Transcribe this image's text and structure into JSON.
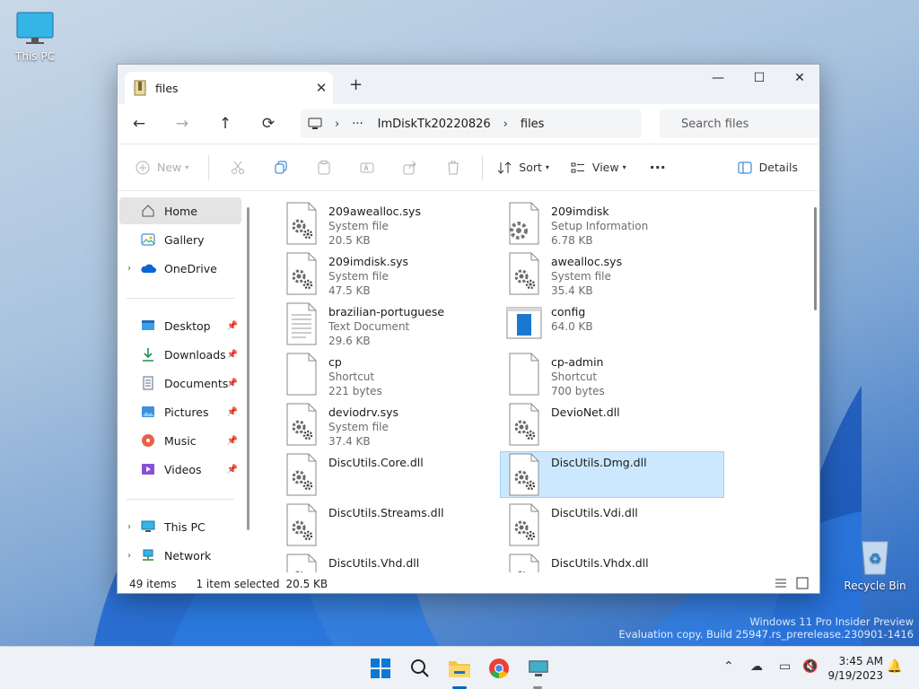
{
  "desktop": {
    "this_pc_label": "This PC",
    "recycle_bin_label": "Recycle Bin",
    "watermark_line1": "Windows 11 Pro Insider Preview",
    "watermark_line2": "Evaluation copy. Build 25947.rs_prerelease.230901-1416"
  },
  "window": {
    "tab_title": "files",
    "tab_close": "✕",
    "new_tab": "+",
    "minimize": "—",
    "maximize": "☐",
    "close": "✕"
  },
  "navbar": {
    "back": "←",
    "forward": "→",
    "up": "↑",
    "refresh": "⟳",
    "more_crumbs": "···",
    "sep": "›",
    "breadcrumb": [
      "ImDiskTk20220826",
      "files"
    ],
    "search_placeholder": "Search files"
  },
  "toolbar": {
    "new_label": "New",
    "sort_label": "Sort",
    "view_label": "View",
    "more": "···",
    "details_label": "Details"
  },
  "sidebar": {
    "home": "Home",
    "gallery": "Gallery",
    "onedrive": "OneDrive",
    "quick_access": [
      "Desktop",
      "Downloads",
      "Documents",
      "Pictures",
      "Music",
      "Videos"
    ],
    "this_pc": "This PC",
    "network": "Network"
  },
  "files": [
    {
      "name": "209awealloc.sys",
      "type": "System file",
      "size": "20.5 KB",
      "icon": "gear-file-icon"
    },
    {
      "name": "209imdisk",
      "type": "Setup Information",
      "size": "6.78 KB",
      "icon": "setup-info-icon"
    },
    {
      "name": "209imdisk.sys",
      "type": "System file",
      "size": "47.5 KB",
      "icon": "gear-file-icon"
    },
    {
      "name": "awealloc.sys",
      "type": "System file",
      "size": "35.4 KB",
      "icon": "gear-file-icon"
    },
    {
      "name": "brazilian-portuguese",
      "type": "Text Document",
      "size": "29.6 KB",
      "icon": "text-file-icon"
    },
    {
      "name": "config",
      "type": "",
      "size": "64.0 KB",
      "icon": "config-file-icon"
    },
    {
      "name": "cp",
      "type": "Shortcut",
      "size": "221 bytes",
      "icon": "blank-file-icon"
    },
    {
      "name": "cp-admin",
      "type": "Shortcut",
      "size": "700 bytes",
      "icon": "blank-file-icon"
    },
    {
      "name": "deviodrv.sys",
      "type": "System file",
      "size": "37.4 KB",
      "icon": "gear-file-icon"
    },
    {
      "name": "DevioNet.dll",
      "type": "",
      "size": "",
      "icon": "gear-file-icon"
    },
    {
      "name": "DiscUtils.Core.dll",
      "type": "",
      "size": "",
      "icon": "gear-file-icon"
    },
    {
      "name": "DiscUtils.Dmg.dll",
      "type": "",
      "size": "",
      "icon": "gear-file-icon",
      "selected": true
    },
    {
      "name": "DiscUtils.Streams.dll",
      "type": "",
      "size": "",
      "icon": "gear-file-icon"
    },
    {
      "name": "DiscUtils.Vdi.dll",
      "type": "",
      "size": "",
      "icon": "gear-file-icon"
    },
    {
      "name": "DiscUtils.Vhd.dll",
      "type": "",
      "size": "",
      "icon": "gear-file-icon"
    },
    {
      "name": "DiscUtils.Vhdx.dll",
      "type": "",
      "size": "",
      "icon": "gear-file-icon"
    }
  ],
  "status": {
    "item_count": "49 items",
    "selection": "1 item selected",
    "selection_size": "20.5 KB"
  },
  "taskbar": {
    "time": "3:45 AM",
    "date": "9/19/2023"
  },
  "colors": {
    "selection_bg": "#cce8ff",
    "selection_border": "#99d1ff",
    "accent": "#0067c0"
  }
}
